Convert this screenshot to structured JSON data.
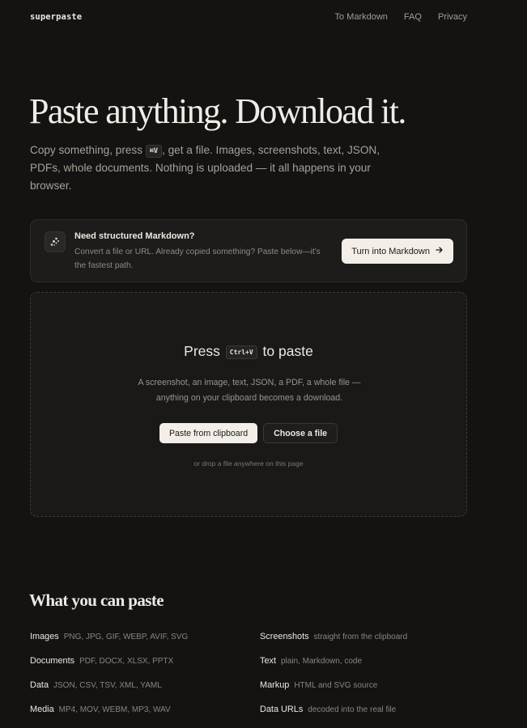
{
  "header": {
    "logo": "superpaste",
    "nav": [
      "To Markdown",
      "FAQ",
      "Privacy"
    ]
  },
  "hero": {
    "title": "Paste anything. Download it.",
    "text_before": "Copy something, press ",
    "shortcut": "⌘V",
    "text_after": ", get a file. Images, screenshots, text, JSON, PDFs, whole documents. Nothing is uploaded — it all happens in your browser."
  },
  "markdown_card": {
    "icon": "sparkle-icon",
    "title": "Need structured Markdown?",
    "description": "Convert a file or URL. Already copied something? Paste below—it's the fastest path.",
    "button_label": "Turn into Markdown",
    "button_icon": "arrow-right-icon"
  },
  "paste_zone": {
    "title_before": "Press",
    "shortcut": "Ctrl+V",
    "title_after": "to paste",
    "description": "A screenshot, an image, text, JSON, a PDF, a whole file — anything on your clipboard becomes a download.",
    "paste_button": "Paste from clipboard",
    "choose_button": "Choose a file",
    "hint": "or drop a file anywhere on this page"
  },
  "formats": {
    "title": "What you can paste",
    "items": [
      {
        "name": "Images",
        "desc": "PNG, JPG, GIF, WEBP, AVIF, SVG"
      },
      {
        "name": "Screenshots",
        "desc": "straight from the clipboard"
      },
      {
        "name": "Documents",
        "desc": "PDF, DOCX, XLSX, PPTX"
      },
      {
        "name": "Text",
        "desc": "plain, Markdown, code"
      },
      {
        "name": "Data",
        "desc": "JSON, CSV, TSV, XML, YAML"
      },
      {
        "name": "Markup",
        "desc": "HTML and SVG source"
      },
      {
        "name": "Media",
        "desc": "MP4, MOV, WEBM, MP3, WAV"
      },
      {
        "name": "Data URLs",
        "desc": "decoded into the real file"
      }
    ]
  },
  "colors": {
    "background": "#141312",
    "card": "#1d1c1a",
    "text": "#ebe7e0",
    "muted": "#a6a198",
    "button_light": "#f3efe8"
  }
}
